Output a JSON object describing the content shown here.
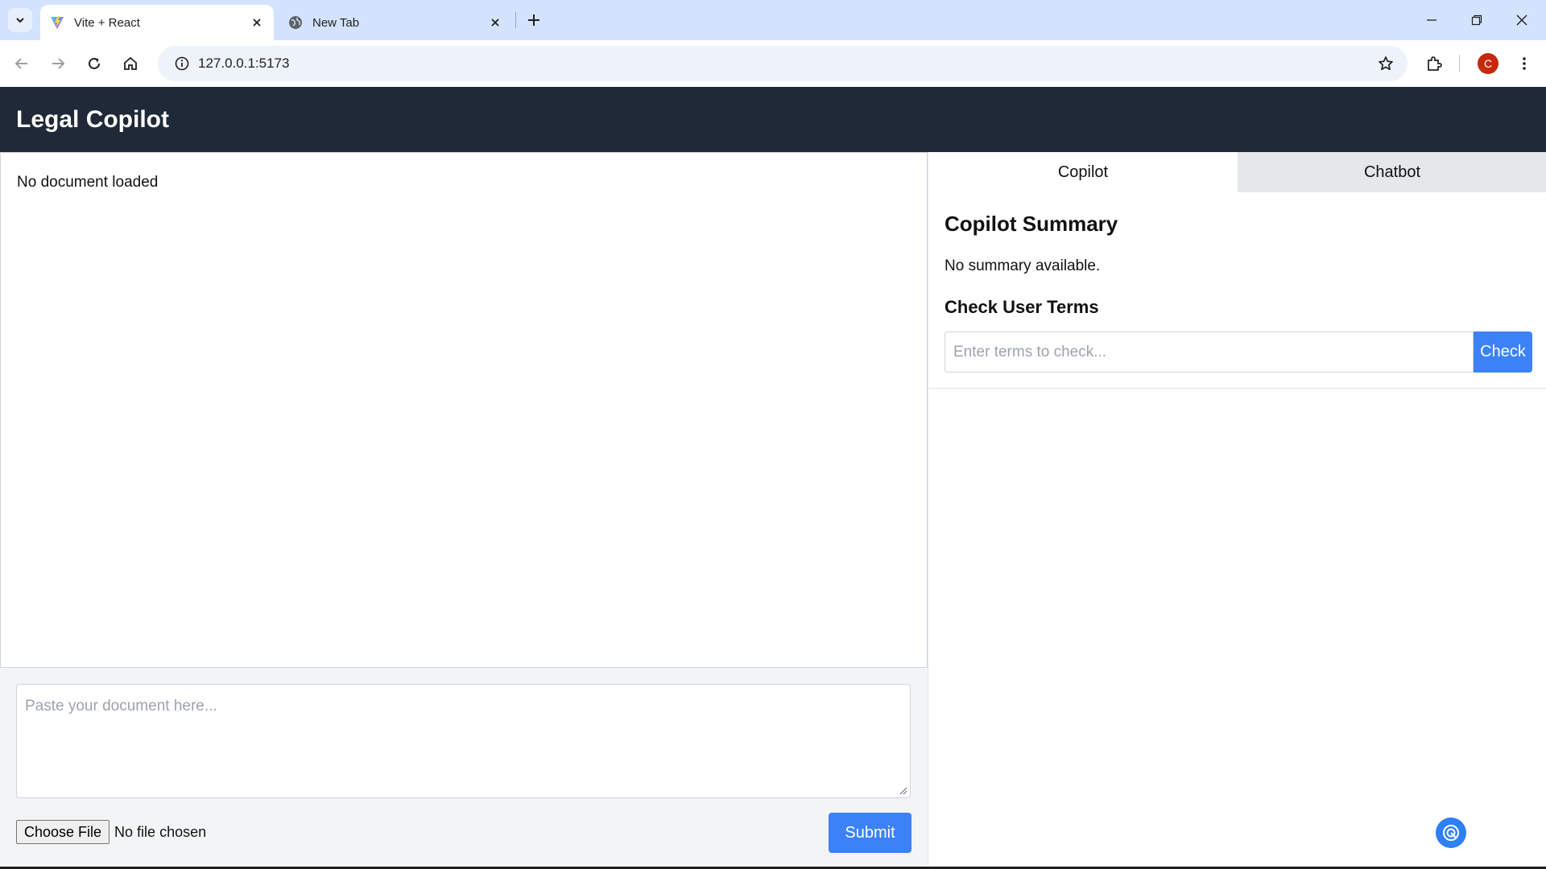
{
  "browser": {
    "tabs": [
      {
        "title": "Vite + React",
        "icon": "vite-icon",
        "active": true
      },
      {
        "title": "New Tab",
        "icon": "globe-icon",
        "active": false
      }
    ],
    "url": "127.0.0.1:5173",
    "profile_initial": "C",
    "profile_color": "#c5290e"
  },
  "app": {
    "title": "Legal Copilot",
    "header_color": "#1f2937",
    "accent_color": "#3b82f6"
  },
  "document": {
    "status": "No document loaded",
    "placeholder": "Paste your document here...",
    "choose_file_label": "Choose File",
    "file_status": "No file chosen",
    "submit_label": "Submit"
  },
  "sidebar": {
    "tabs": [
      {
        "label": "Copilot",
        "active": true
      },
      {
        "label": "Chatbot",
        "active": false
      }
    ],
    "summary_heading": "Copilot Summary",
    "summary_text": "No summary available.",
    "check_heading": "Check User Terms",
    "check_placeholder": "Enter terms to check...",
    "check_label": "Check"
  }
}
